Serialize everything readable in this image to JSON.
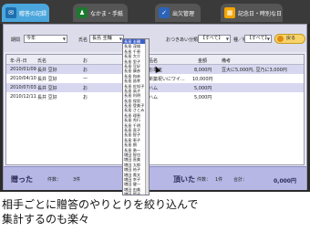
{
  "tabs": [
    {
      "label": "贈答の記録",
      "icon": "gift-icon",
      "color": "#3aa3e0"
    },
    {
      "label": "なかま・手紙",
      "icon": "person-icon",
      "color": "#1b7a2e"
    },
    {
      "label": "出欠管理",
      "icon": "check-icon",
      "color": "#2a63b8"
    },
    {
      "label": "記念日・時別な日",
      "icon": "calendar-icon",
      "color": "#f2a500"
    }
  ],
  "filters": {
    "period_label": "期間",
    "period_value": "今年",
    "name_label": "氏名",
    "name_value": "長島 圭輔",
    "occasion_label": "おつきあい分類",
    "occasion_value": "【すべて】",
    "type_label": "種／贈",
    "type_value": "【すべて】",
    "back_label": "戻る"
  },
  "table": {
    "headers": [
      "年-月-日",
      "氏名",
      "お",
      "品名",
      "金額",
      "備考"
    ],
    "rows": [
      {
        "date": "2010/01/09",
        "name": "長井 豆好",
        "kind": "お",
        "item": "お年玉",
        "amount": "8,000円",
        "note": "豆大に5,000円, 豆乃に3,000円"
      },
      {
        "date": "2010/04/10",
        "name": "長井 豆好",
        "kind": "一",
        "item": "新築祝いにワイ...",
        "amount": "10,000円",
        "note": ""
      },
      {
        "date": "2010/07/03",
        "name": "長井 豆好",
        "kind": "お",
        "item": "ハム",
        "amount": "5,000円",
        "note": ""
      },
      {
        "date": "2010/12/11",
        "name": "長井 豆好",
        "kind": "お",
        "item": "ハム",
        "amount": "5,000円",
        "note": ""
      }
    ]
  },
  "dropdown_items": [
    "長島 圭輔",
    "長島 茂雄",
    "長島 千恵",
    "長島 大介",
    "長島 里子",
    "長島 豆好",
    "長島 康彦",
    "長島 和彦",
    "長島 昌孝",
    "長島 佐知子",
    "長島 高子",
    "長島 利明",
    "長島 保男",
    "長島 登美子",
    "長島 さとみ",
    "長島 理恵",
    "長島 秀行",
    "長島 千明",
    "長島 直子",
    "長島 智子",
    "長島 恵子",
    "長島 朗",
    "長島 勇一",
    "増田 智也",
    "増田 直美",
    "増田 太郎",
    "増田 祐子",
    "増田 貴文",
    "増田 幸子",
    "増田 健一",
    "増田 由美",
    "増田 陽子"
  ],
  "footer": {
    "given_label": "贈った",
    "given_count_label": "件数：",
    "given_count": "3件",
    "received_label": "頂いた",
    "received_count_label": "件数：",
    "received_count": "1件",
    "total_label": "合計：",
    "total_value": "0,000円",
    "right_value": "0,000円"
  },
  "caption": {
    "line1": "相手ごとに贈答のやりとりを絞り込んで",
    "line2": "集計するのも楽々"
  }
}
